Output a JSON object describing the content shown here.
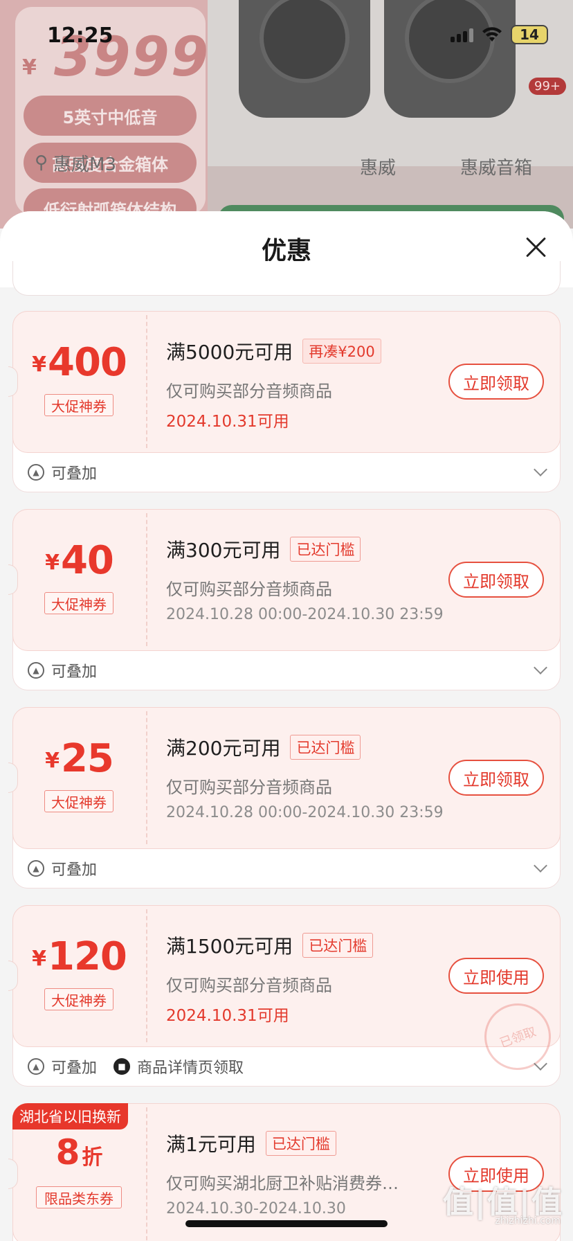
{
  "status_bar": {
    "time": "12:25",
    "battery": "14"
  },
  "background": {
    "price_symbol": "¥",
    "price": "3999",
    "features": [
      "5英寸中低音",
      "高强度合金箱体",
      "低衍射弧箱体结构"
    ],
    "search_text": "惠威M3",
    "tabs": [
      "惠威",
      "惠威音箱"
    ],
    "badge": "99+"
  },
  "sheet": {
    "title": "优惠"
  },
  "coupons": [
    {
      "symbol": "¥",
      "amount": "400",
      "unit": "",
      "type_label": "大促神券",
      "condition": "满5000元可用",
      "condition_badge": "再凑¥200",
      "scope": "仅可购买部分音频商品",
      "validity": "2024.10.31可用",
      "action": "立即领取",
      "stackable": "可叠加",
      "extra_note": ""
    },
    {
      "symbol": "¥",
      "amount": "40",
      "unit": "",
      "type_label": "大促神券",
      "condition": "满300元可用",
      "condition_badge": "已达门槛",
      "scope": "仅可购买部分音频商品",
      "validity": "2024.10.28 00:00-2024.10.30 23:59",
      "action": "立即领取",
      "stackable": "可叠加",
      "extra_note": ""
    },
    {
      "symbol": "¥",
      "amount": "25",
      "unit": "",
      "type_label": "大促神券",
      "condition": "满200元可用",
      "condition_badge": "已达门槛",
      "scope": "仅可购买部分音频商品",
      "validity": "2024.10.28 00:00-2024.10.30 23:59",
      "action": "立即领取",
      "stackable": "可叠加",
      "extra_note": ""
    },
    {
      "symbol": "¥",
      "amount": "120",
      "unit": "",
      "type_label": "大促神券",
      "condition": "满1500元可用",
      "condition_badge": "已达门槛",
      "scope": "仅可购买部分音频商品",
      "validity": "2024.10.31可用",
      "action": "立即使用",
      "stackable": "可叠加",
      "extra_note": "商品详情页领取",
      "stamp": "已领取"
    },
    {
      "symbol": "",
      "amount": "8",
      "unit": "折",
      "type_label": "限品类东券",
      "corner_tag": "湖北省以旧换新",
      "condition": "满1元可用",
      "condition_badge": "已达门槛",
      "scope": "仅可购买湖北厨卫补贴消费券…",
      "validity": "2024.10.30-2024.10.30",
      "action": "立即使用"
    }
  ],
  "watermark": {
    "main": "值|值|值",
    "sub": "zhizhizhi.com"
  },
  "colors": {
    "accent": "#e3392c",
    "coupon_bg": "#fdf0ee"
  }
}
